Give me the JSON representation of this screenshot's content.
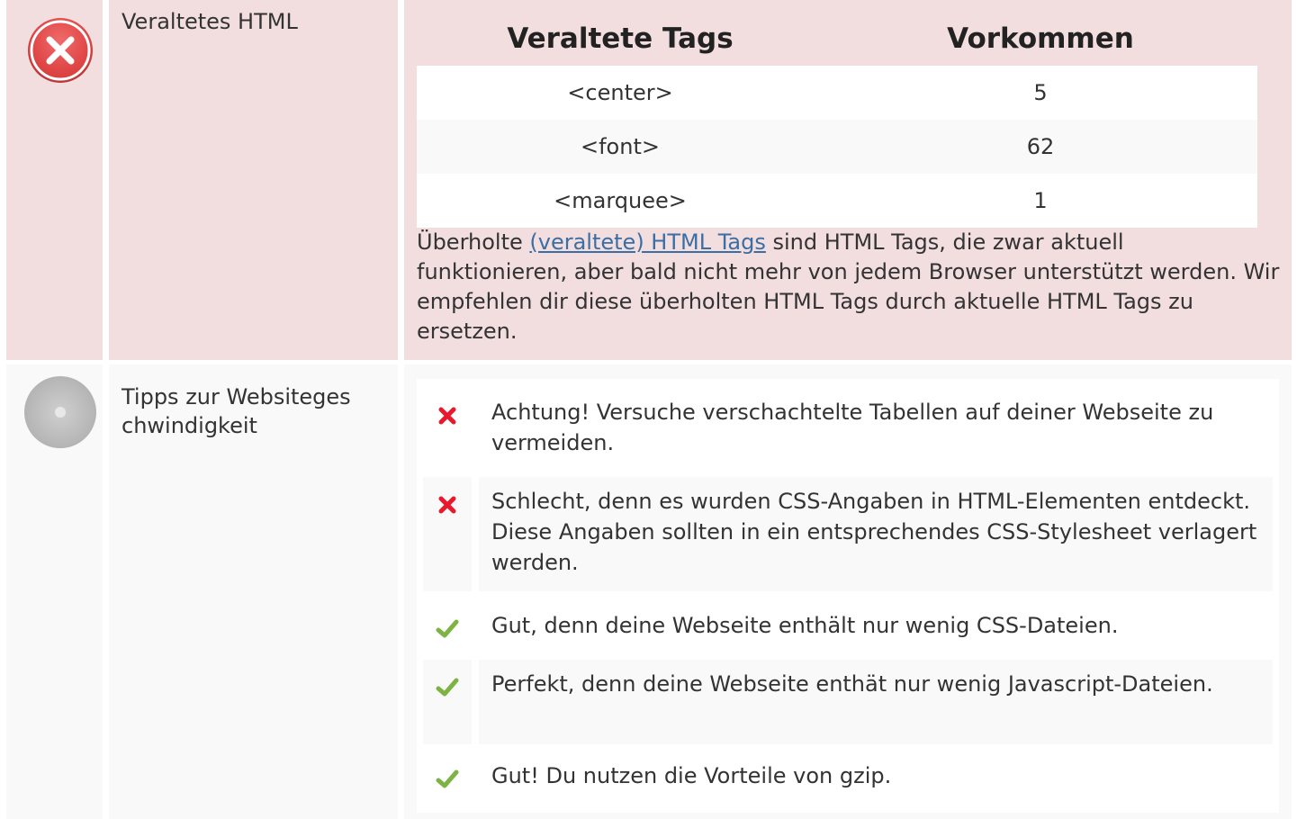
{
  "colors": {
    "error_bg": "#f2dede",
    "neutral_bg": "#f9f9f9",
    "link": "#3a6ea5",
    "cross": "#e8192c",
    "check": "#7cb342"
  },
  "obsolete": {
    "status_icon": "error-circle-icon",
    "label": "Veraltetes HTML",
    "table": {
      "headers": [
        "Veraltete Tags",
        "Vorkommen"
      ],
      "rows": [
        {
          "tag": "<center>",
          "count": "5"
        },
        {
          "tag": "<font>",
          "count": "62"
        },
        {
          "tag": "<marquee>",
          "count": "1"
        }
      ]
    },
    "description": {
      "before": "Überholte ",
      "link": "(veraltete) HTML Tags",
      "after": " sind HTML Tags, die zwar aktuell funktionieren, aber bald nicht mehr von jedem Browser unterstützt werden. Wir empfehlen dir diese überholten HTML Tags durch aktuelle HTML Tags zu ersetzen."
    }
  },
  "speed": {
    "status_icon": "neutral-circle-icon",
    "label": "Tipps zur Websiteges chwindigkeit",
    "tips": [
      {
        "status": "bad",
        "icon": "cross-icon",
        "text": "Achtung! Versuche verschachtelte Tabellen auf deiner Webseite zu vermeiden."
      },
      {
        "status": "bad",
        "icon": "cross-icon",
        "text": "Schlecht, denn es wurden CSS-Angaben in HTML-Elementen entdeckt. Diese Angaben sollten in ein entsprechendes CSS-Stylesheet verlagert werden."
      },
      {
        "status": "good",
        "icon": "check-icon",
        "text": "Gut, denn deine Webseite enthält nur wenig CSS-Dateien."
      },
      {
        "status": "good",
        "icon": "check-icon",
        "text": "Perfekt, denn deine Webseite enthät nur wenig Javascript-Dateien."
      },
      {
        "status": "good",
        "icon": "check-icon",
        "text": "Gut! Du nutzen die Vorteile von gzip."
      }
    ]
  }
}
